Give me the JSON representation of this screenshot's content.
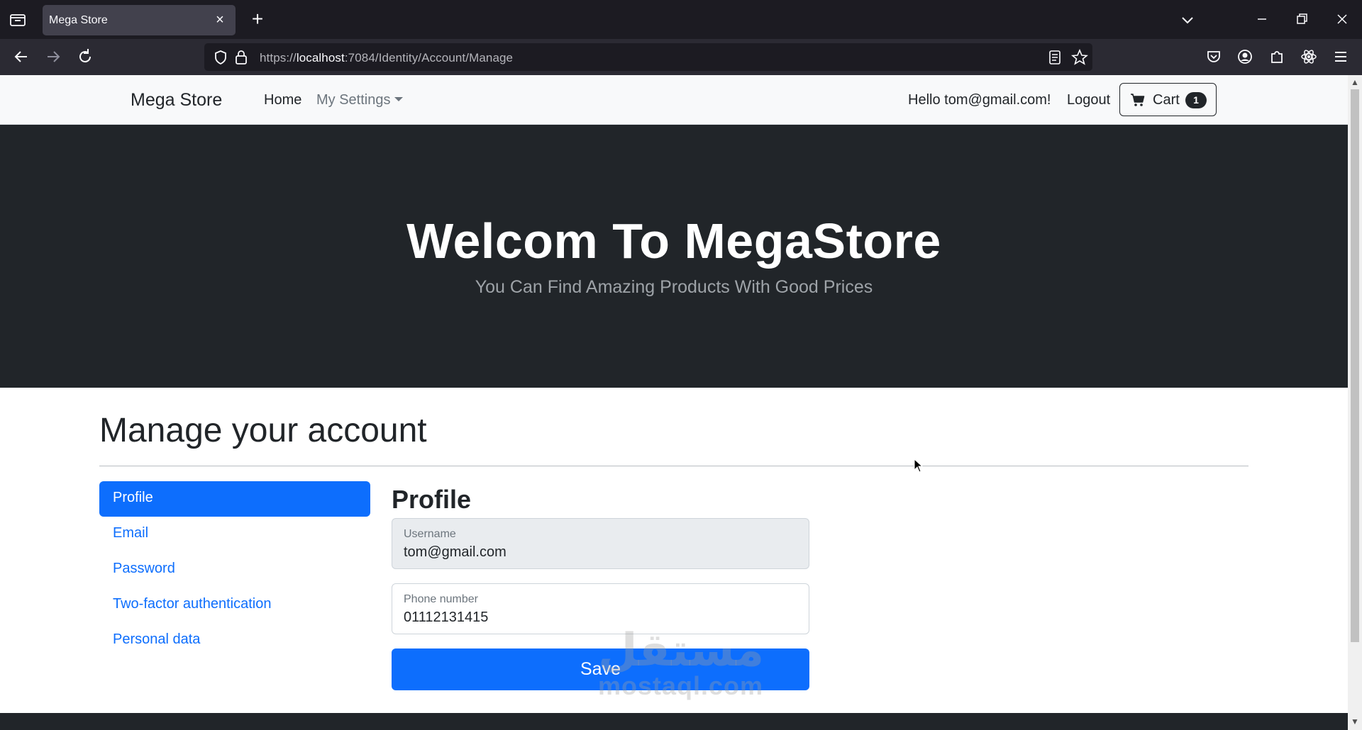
{
  "browser": {
    "tab_title": "Mega Store",
    "url_prefix": "https://",
    "url_host": "localhost",
    "url_rest": ":7084/Identity/Account/Manage"
  },
  "site_nav": {
    "brand": "Mega Store",
    "home": "Home",
    "settings": "My Settings",
    "hello": "Hello tom@gmail.com!",
    "logout": "Logout",
    "cart_label": "Cart",
    "cart_count": "1"
  },
  "hero": {
    "title": "Welcom To MegaStore",
    "subtitle": "You Can Find Amazing Products With Good Prices"
  },
  "manage": {
    "title": "Manage your account",
    "side_items": [
      {
        "label": "Profile"
      },
      {
        "label": "Email"
      },
      {
        "label": "Password"
      },
      {
        "label": "Two-factor authentication"
      },
      {
        "label": "Personal data"
      }
    ],
    "active_index": 0
  },
  "profile": {
    "title": "Profile",
    "username_label": "Username",
    "username_value": "tom@gmail.com",
    "phone_label": "Phone number",
    "phone_value": "01112131415",
    "save_label": "Save"
  },
  "watermark": {
    "arabic": "مستقل",
    "latin": "mostaql.com"
  },
  "colors": {
    "primary": "#0d6efd",
    "dark": "#212529",
    "chrome_bg": "#1c1b22"
  }
}
